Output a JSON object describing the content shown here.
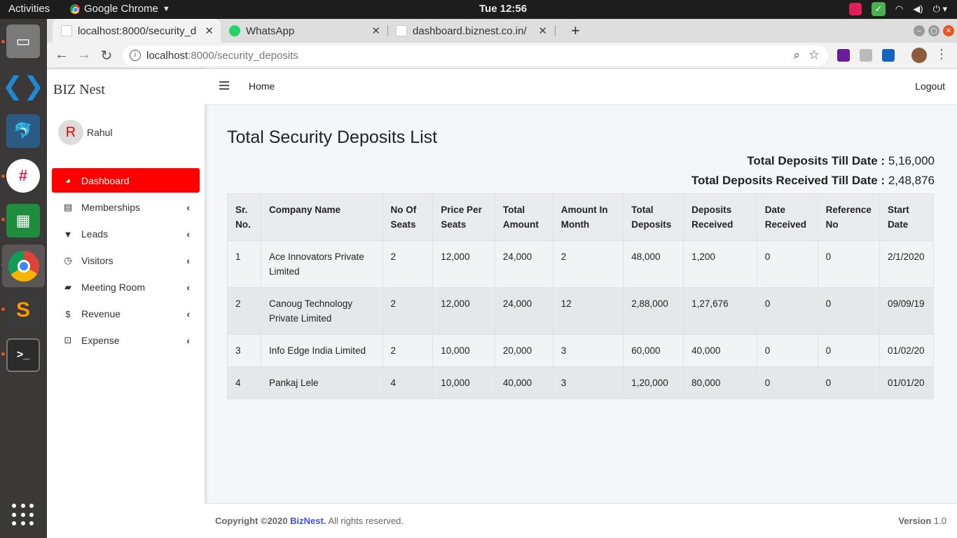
{
  "os": {
    "activities": "Activities",
    "app_name": "Google Chrome",
    "clock": "Tue 12:56"
  },
  "browser": {
    "tabs": [
      {
        "title": "localhost:8000/security_d",
        "active": true
      },
      {
        "title": "WhatsApp",
        "active": false
      },
      {
        "title": "dashboard.biznest.co.in/",
        "active": false
      }
    ],
    "url_host": "localhost",
    "url_rest": ":8000/security_deposits"
  },
  "app": {
    "brand": "BIZ Nest",
    "user": {
      "initial": "R",
      "name": "Rahul"
    },
    "nav": [
      {
        "label": "Dashboard",
        "icon": "tachometer-icon",
        "active": true
      },
      {
        "label": "Memberships",
        "icon": "id-card-icon"
      },
      {
        "label": "Leads",
        "icon": "filter-icon"
      },
      {
        "label": "Visitors",
        "icon": "clock-icon"
      },
      {
        "label": "Meeting Room",
        "icon": "book-icon"
      },
      {
        "label": "Revenue",
        "icon": "dollar-icon"
      },
      {
        "label": "Expense",
        "icon": "money-bill-icon"
      }
    ],
    "header": {
      "home": "Home",
      "logout": "Logout"
    }
  },
  "main": {
    "title": "Total Security Deposits List",
    "total_deposits_label": "Total Deposits Till Date :",
    "total_deposits_value": "5,16,000",
    "total_received_label": "Total Deposits Received Till Date :",
    "total_received_value": "2,48,876",
    "columns": [
      "Sr. No.",
      "Company Name",
      "No Of Seats",
      "Price Per Seats",
      "Total Amount",
      "Amount In Month",
      "Total Deposits",
      "Deposits Received",
      "Date Received",
      "Reference No",
      "Start Date"
    ],
    "rows": [
      [
        "1",
        "Ace Innovators Private Limited",
        "2",
        "12,000",
        "24,000",
        "2",
        "48,000",
        "1,200",
        "0",
        "0",
        "2/1/2020"
      ],
      [
        "2",
        "Canoug Technology Private Limited",
        "2",
        "12,000",
        "24,000",
        "12",
        "2,88,000",
        "1,27,676",
        "0",
        "0",
        "09/09/19"
      ],
      [
        "3",
        "Info Edge India Limited",
        "2",
        "10,000",
        "20,000",
        "3",
        "60,000",
        "40,000",
        "0",
        "0",
        "01/02/20"
      ],
      [
        "4",
        "Pankaj Lele",
        "4",
        "10,000",
        "40,000",
        "3",
        "1,20,000",
        "80,000",
        "0",
        "0",
        "01/01/20"
      ]
    ]
  },
  "footer": {
    "copyright": "Copyright ©2020",
    "brand": "BizNest.",
    "rights": "All rights reserved.",
    "version_label": "Version",
    "version": "1.0"
  },
  "colors": {
    "accent": "#ff0000",
    "link": "#3f51e0"
  }
}
